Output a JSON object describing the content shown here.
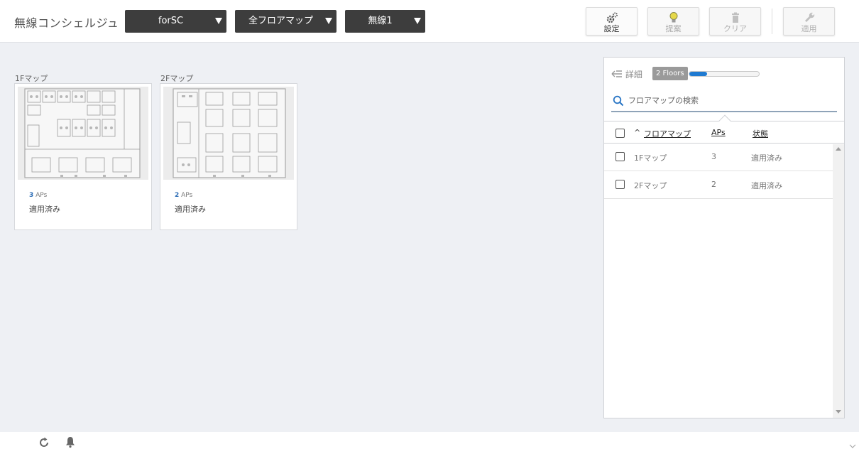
{
  "header": {
    "app_title": "無線コンシェルジュ",
    "dropdowns": [
      {
        "label": "forSC"
      },
      {
        "label": "全フロアマップ"
      },
      {
        "label": "無線1"
      }
    ],
    "toolbar": {
      "settings_label": "設定",
      "suggest_label": "提案",
      "clear_label": "クリア",
      "apply_label": "適用"
    }
  },
  "floor_cards": [
    {
      "caption": "1Fマップ",
      "aps_count": "3",
      "aps_unit": "APs",
      "status": "適用済み"
    },
    {
      "caption": "2Fマップ",
      "aps_count": "2",
      "aps_unit": "APs",
      "status": "適用済み"
    }
  ],
  "panel": {
    "detail_label": "詳細",
    "floors_badge": "2 Floors",
    "progress_fraction": 0.26,
    "search_placeholder": "フロアマップの検索",
    "columns": {
      "sort_arrow": "^",
      "floor_map": "フロアマップ",
      "aps": "APs",
      "status": "状態"
    },
    "rows": [
      {
        "name": "1Fマップ",
        "aps": "3",
        "status": "適用済み"
      },
      {
        "name": "2Fマップ",
        "aps": "2",
        "status": "適用済み"
      }
    ]
  },
  "colors": {
    "accent": "#1f7ad1",
    "dropdown_bg": "#3d3d3d",
    "page_bg": "#eef0f4"
  }
}
